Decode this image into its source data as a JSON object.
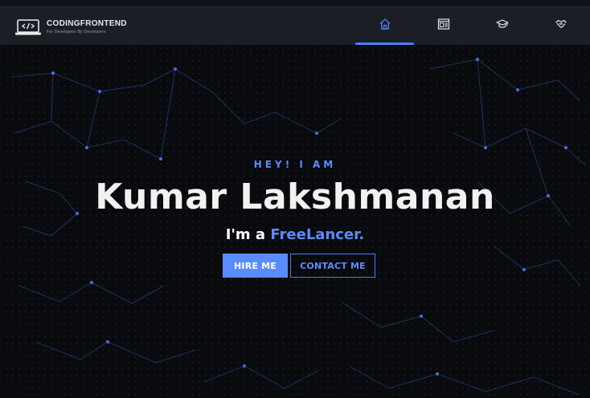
{
  "brand": {
    "name": "CODINGFRONTEND",
    "tagline": "For Developers By Developers"
  },
  "nav": {
    "items": [
      {
        "icon": "home-icon",
        "active": true
      },
      {
        "icon": "resume-icon",
        "active": false
      },
      {
        "icon": "graduation-cap-icon",
        "active": false
      },
      {
        "icon": "handshake-icon",
        "active": false
      }
    ]
  },
  "hero": {
    "greeting": "HEY! I AM",
    "name": "Kumar Lakshmanan",
    "role_prefix": "I'm a",
    "role_highlight": "FreeLancer."
  },
  "buttons": {
    "hire": "HIRE ME",
    "contact": "CONTACT ME"
  },
  "colors": {
    "accent": "#5b8cff",
    "nav_bg": "#1b1e24",
    "page_bg": "#090a0d"
  }
}
